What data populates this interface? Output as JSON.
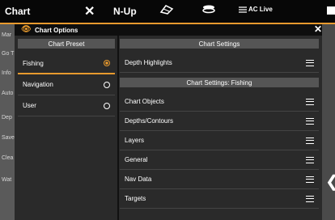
{
  "topbar": {
    "title": "Chart",
    "close_glyph": "✕",
    "nup_label": "N-Up",
    "icon1": "fish-icon",
    "icon2": "layers-icon",
    "aclive_label": "AC Live"
  },
  "left_hidden": [
    "Mar",
    "Go T",
    "Info",
    "Auto",
    "Dep",
    "Save",
    "Clea",
    "Wat"
  ],
  "dialog": {
    "title": "Chart Options",
    "preset_header": "Chart Preset",
    "presets": [
      {
        "label": "Fishing",
        "selected": true
      },
      {
        "label": "Navigation",
        "selected": false
      },
      {
        "label": "User",
        "selected": false
      }
    ],
    "settings_header": "Chart Settings",
    "depth_highlights": "Depth Highlights",
    "fishing_header": "Chart Settings: Fishing",
    "items": [
      "Chart Objects",
      "Depths/Contours",
      "Layers",
      "General",
      "Nav Data",
      "Targets"
    ]
  },
  "colors": {
    "accent": "#e89a2e",
    "panel": "#2a2a2a"
  }
}
